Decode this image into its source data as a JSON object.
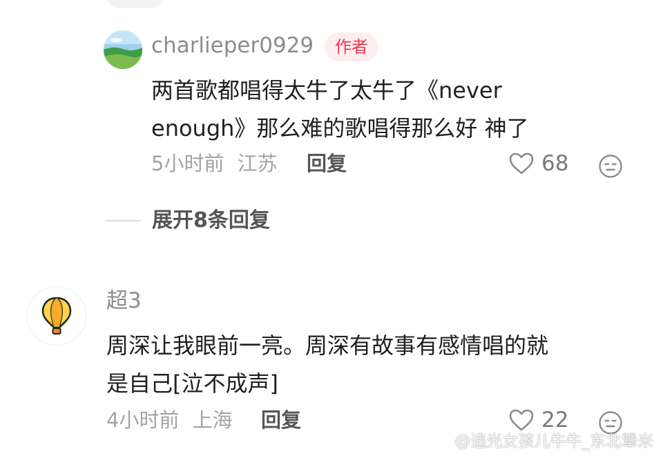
{
  "comments": [
    {
      "username": "charlieper0929",
      "badge": "作者",
      "text_lines": [
        "两首歌都唱得太牛了太牛了《never",
        "enough》那么难的歌唱得那么好 神了"
      ],
      "time": "5小时前",
      "location": "江苏",
      "reply_label": "回复",
      "likes": "68",
      "expand_label": "展开8条回复"
    },
    {
      "username": "超3",
      "text_lines": [
        "周深让我眼前一亮。周深有故事有感情唱的就",
        "是自己[泣不成声]"
      ],
      "time": "4小时前",
      "location": "上海",
      "reply_label": "回复",
      "likes": "22"
    }
  ],
  "icons": {
    "like": "heart-outline-icon",
    "dislike": "neutral-face-icon",
    "avatar_2": "hot-air-balloon-icon",
    "watermark": "weibo-logo-icon"
  },
  "watermark": {
    "text": "@追光女孩儿牛牛_东北犟米"
  },
  "colors": {
    "badge_text": "#f03a4e",
    "badge_bg": "#ffeef0",
    "username": "#8c8c8c",
    "meta": "#a3a3a3"
  }
}
